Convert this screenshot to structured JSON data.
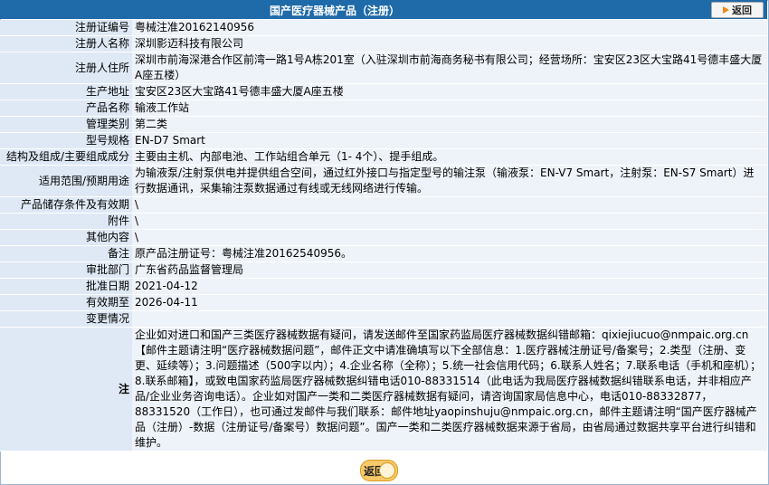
{
  "header": {
    "title": "国产医疗器械产品（注册）",
    "back_label": "返回"
  },
  "rows": [
    {
      "label": "注册证编号",
      "value": "粤械注准20162140956"
    },
    {
      "label": "注册人名称",
      "value": "深圳影迈科技有限公司"
    },
    {
      "label": "注册人住所",
      "value": "深圳市前海深港合作区前湾一路1号A栋201室（入驻深圳市前海商务秘书有限公司；经营场所：宝安区23区大宝路41号德丰盛大厦A座五楼）"
    },
    {
      "label": "生产地址",
      "value": "宝安区23区大宝路41号德丰盛大厦A座五楼"
    },
    {
      "label": "产品名称",
      "value": "输液工作站"
    },
    {
      "label": "管理类别",
      "value": "第二类"
    },
    {
      "label": "型号规格",
      "value": "EN-D7 Smart"
    },
    {
      "label": "结构及组成/主要组成成分",
      "value": "主要由主机、内部电池、工作站组合单元（1- 4个）、提手组成。"
    },
    {
      "label": "适用范围/预期用途",
      "value": "为输液泵/注射泵供电并提供组合空间，通过红外接口与指定型号的输注泵（输液泵：EN-V7 Smart，注射泵：EN-S7 Smart）进行数据通讯，采集输注泵数据通过有线或无线网络进行传输。"
    },
    {
      "label": "产品储存条件及有效期",
      "value": "\\"
    },
    {
      "label": "附件",
      "value": "\\"
    },
    {
      "label": "其他内容",
      "value": "\\"
    },
    {
      "label": "备注",
      "value": "原产品注册证号：粤械注准20162540956。"
    },
    {
      "label": "审批部门",
      "value": "广东省药品监督管理局"
    },
    {
      "label": "批准日期",
      "value": "2021-04-12"
    },
    {
      "label": "有效期至",
      "value": "2026-04-11"
    },
    {
      "label": "变更情况",
      "value": ""
    }
  ],
  "note": {
    "label": "注",
    "text": "企业如对进口和国产三类医疗器械数据有疑问，请发送邮件至国家药监局医疗器械数据纠错邮箱：qixiejiucuo@nmpaic.org.cn【邮件主题请注明“医疗器械数据问题”，邮件正文中请准确填写以下全部信息：1.医疗器械注册证号/备案号；2.类型（注册、变更、延续等）；3.问题描述（500字以内）；4.企业名称（全称）；5.统一社会信用代码；6.联系人姓名；7.联系电话（手机和座机）；8.联系邮箱】，或致电国家药监局医疗器械数据纠错电话010-88331514（此电话为我局医疗器械数据纠错联系电话，并非相应产品/企业业务咨询电话）。企业如对国产一类和二类医疗器械数据有疑问，请咨询国家局信息中心，电话010-88332877，88331520（工作日），也可通过发邮件与我们联系：邮件地址yaopinshuju@nmpaic.org.cn，邮件主题请注明“国产医疗器械产品（注册）-数据（注册证号/备案号）数据问题”。国产一类和二类医疗器械数据来源于省局，由省局通过数据共享平台进行纠错和维护。"
  },
  "footer": {
    "back_label": "返回"
  },
  "colors": {
    "header_bg": "#1f6aa8",
    "label_bg": "#dfe9f5",
    "value_bg": "#eef3f9",
    "accent": "#f08a12"
  }
}
